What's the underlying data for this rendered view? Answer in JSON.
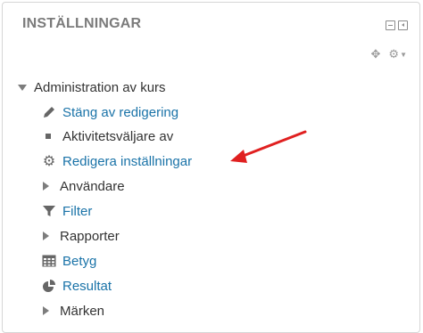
{
  "block": {
    "title": "INSTÄLLNINGAR"
  },
  "tree": {
    "root_label": "Administration av kurs",
    "items": [
      {
        "label": "Stäng av redigering",
        "icon": "pencil-icon",
        "link": true
      },
      {
        "label": "Aktivitetsväljare av",
        "icon": "square-bullet-icon",
        "link": false
      },
      {
        "label": "Redigera inställningar",
        "icon": "gear-icon",
        "link": true
      },
      {
        "label": "Användare",
        "icon": "expand-triangle-icon",
        "link": false
      },
      {
        "label": "Filter",
        "icon": "filter-icon",
        "link": true
      },
      {
        "label": "Rapporter",
        "icon": "expand-triangle-icon",
        "link": false
      },
      {
        "label": "Betyg",
        "icon": "grades-table-icon",
        "link": true
      },
      {
        "label": "Resultat",
        "icon": "outcomes-pie-icon",
        "link": true
      },
      {
        "label": "Märken",
        "icon": "expand-triangle-icon",
        "link": false
      }
    ]
  },
  "colors": {
    "link": "#1a73a8",
    "annotation_arrow": "#e02020"
  }
}
